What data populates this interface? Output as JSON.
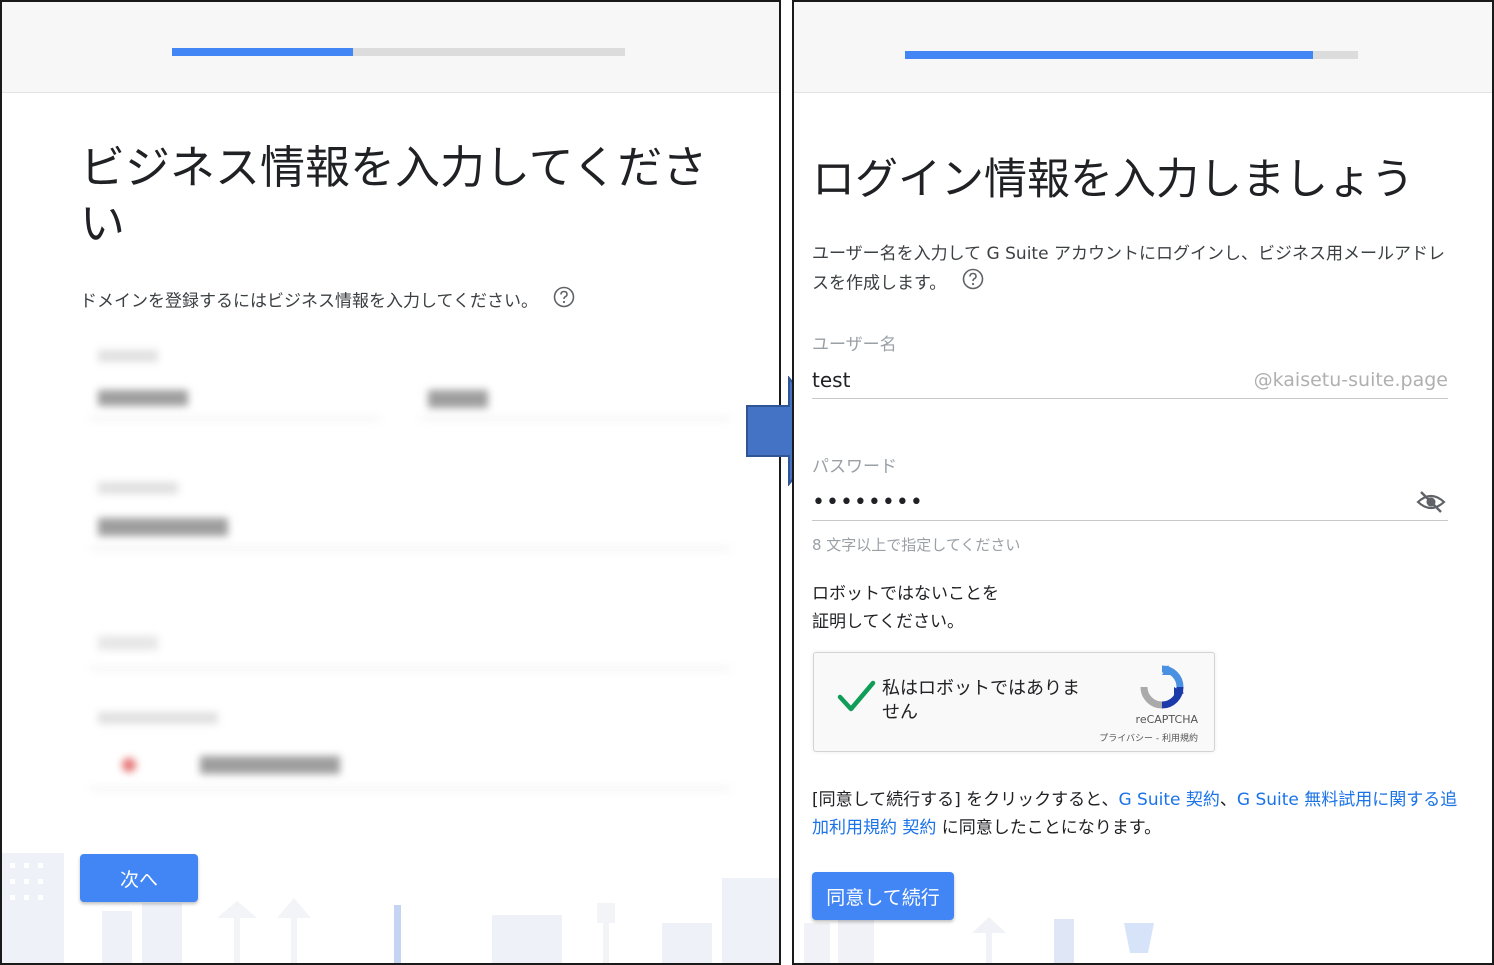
{
  "left": {
    "progress": 0.4,
    "heading": "ビジネス情報を入力してください",
    "description": "ドメインを登録するにはビジネス情報を入力してください。",
    "next_button": "次へ"
  },
  "right": {
    "progress": 0.9,
    "heading": "ログイン情報を入力しましょう",
    "description": "ユーザー名を入力して G Suite アカウントにログインし、ビジネス用メールアドレスを作成します。",
    "username_label": "ユーザー名",
    "username_value": "test",
    "domain_suffix": "@kaisetu-suite.page",
    "password_label": "パスワード",
    "password_value": "••••••••",
    "password_hint": "8 文字以上で指定してください",
    "robot_prompt_line1": "ロボットではないことを",
    "robot_prompt_line2": "証明してください。",
    "recaptcha_label": "私はロボットではありません",
    "recaptcha_brand": "reCAPTCHA",
    "recaptcha_links": "プライバシー - 利用規約",
    "terms_prefix": "[同意して続行する] をクリックすると、",
    "terms_link1": "G Suite 契約",
    "terms_sep": "、",
    "terms_link2": "G Suite 無料試用に関する追加利用規約 契約",
    "terms_suffix": " に同意したことになります。",
    "agree_button": "同意して続行"
  },
  "colors": {
    "accent": "#4285f4",
    "link": "#1a73e8",
    "arrow": "#4472c4",
    "check": "#0f9d58"
  },
  "icons": [
    "help-icon",
    "visibility-off-icon",
    "checkmark-icon",
    "recaptcha-logo-icon",
    "arrow-right-icon"
  ]
}
